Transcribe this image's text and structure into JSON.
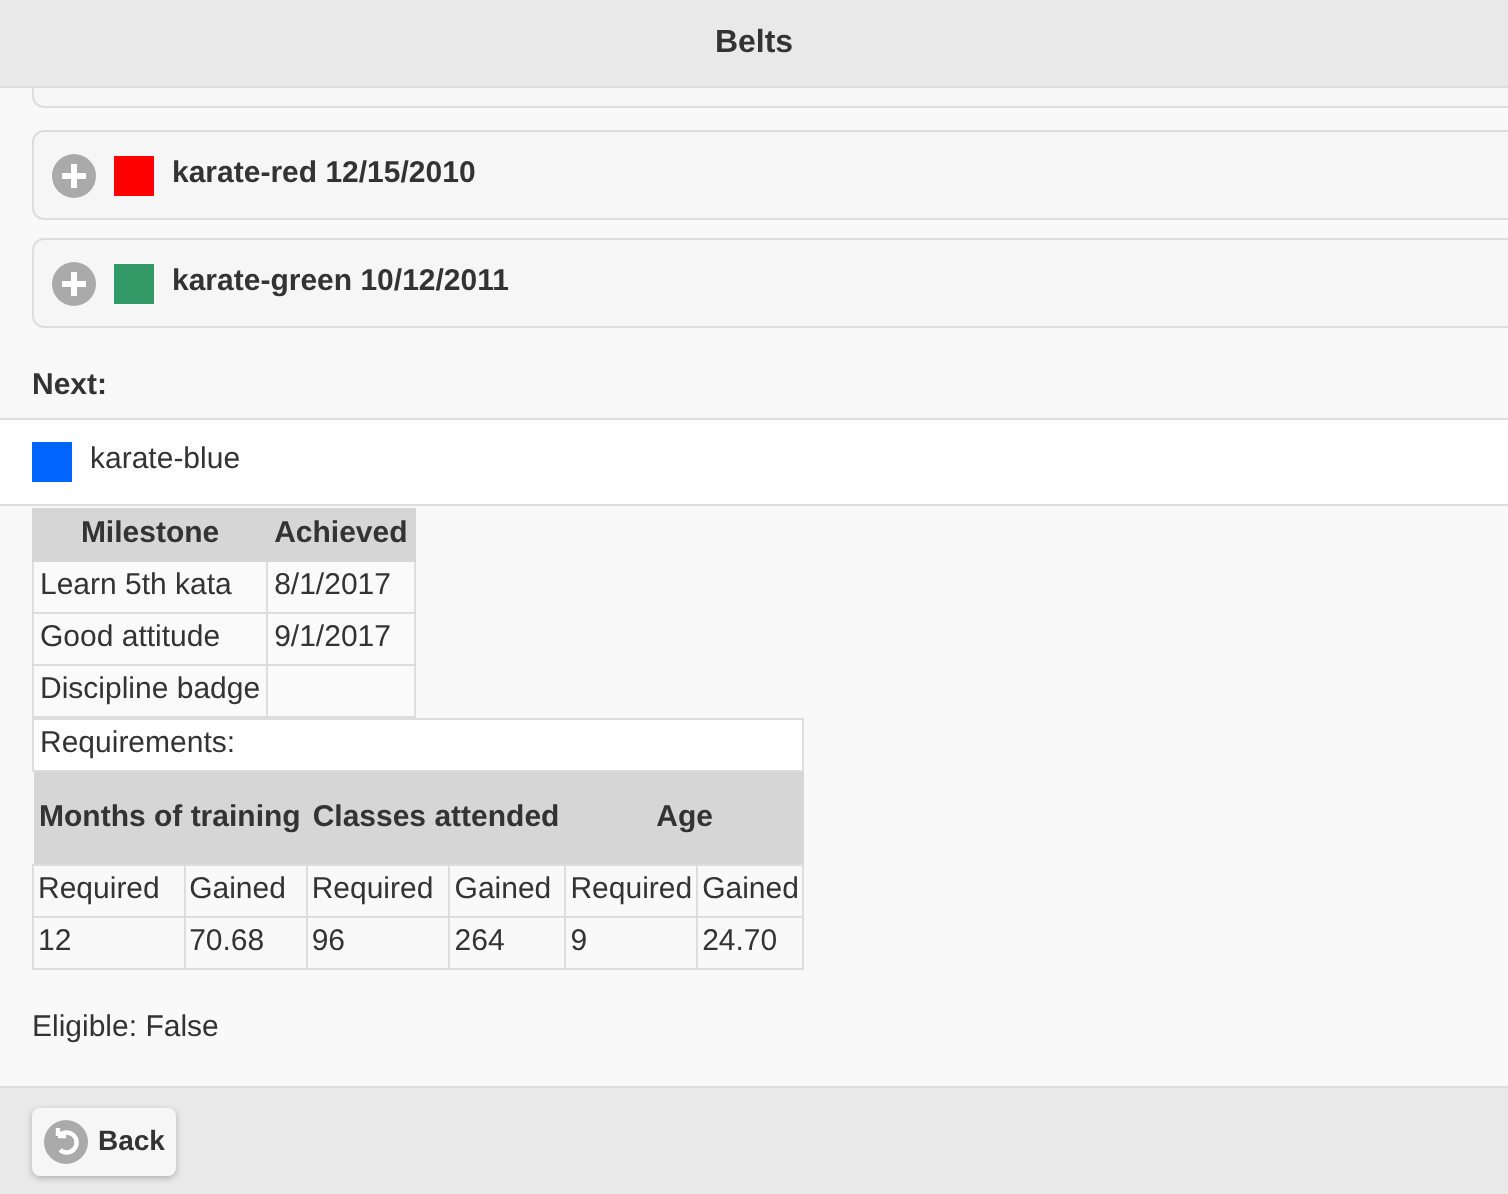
{
  "header": {
    "title": "Belts"
  },
  "belts": [
    {
      "label": "karate-red 12/15/2010",
      "color": "#ff0000",
      "expanded": false
    },
    {
      "label": "karate-green 10/12/2011",
      "color": "#339966",
      "expanded": false
    }
  ],
  "next": {
    "label": "Next:",
    "belt": {
      "label": "karate-blue",
      "color": "#0066ff"
    }
  },
  "milestones": {
    "columns": [
      "Milestone",
      "Achieved"
    ],
    "rows": [
      [
        "Learn 5th kata",
        "8/1/2017"
      ],
      [
        "Good attitude",
        "9/1/2017"
      ],
      [
        "Discipline badge",
        ""
      ]
    ]
  },
  "requirements": {
    "label": "Requirements:",
    "groups": [
      "Months of training",
      "Classes attended",
      "Age"
    ],
    "subcolumns": [
      "Required",
      "Gained",
      "Required",
      "Gained",
      "Required",
      "Gained"
    ],
    "values": [
      "12",
      "70.68",
      "96",
      "264",
      "9",
      "24.70"
    ]
  },
  "eligible": "Eligible: False",
  "footer": {
    "back_button": "Back"
  }
}
